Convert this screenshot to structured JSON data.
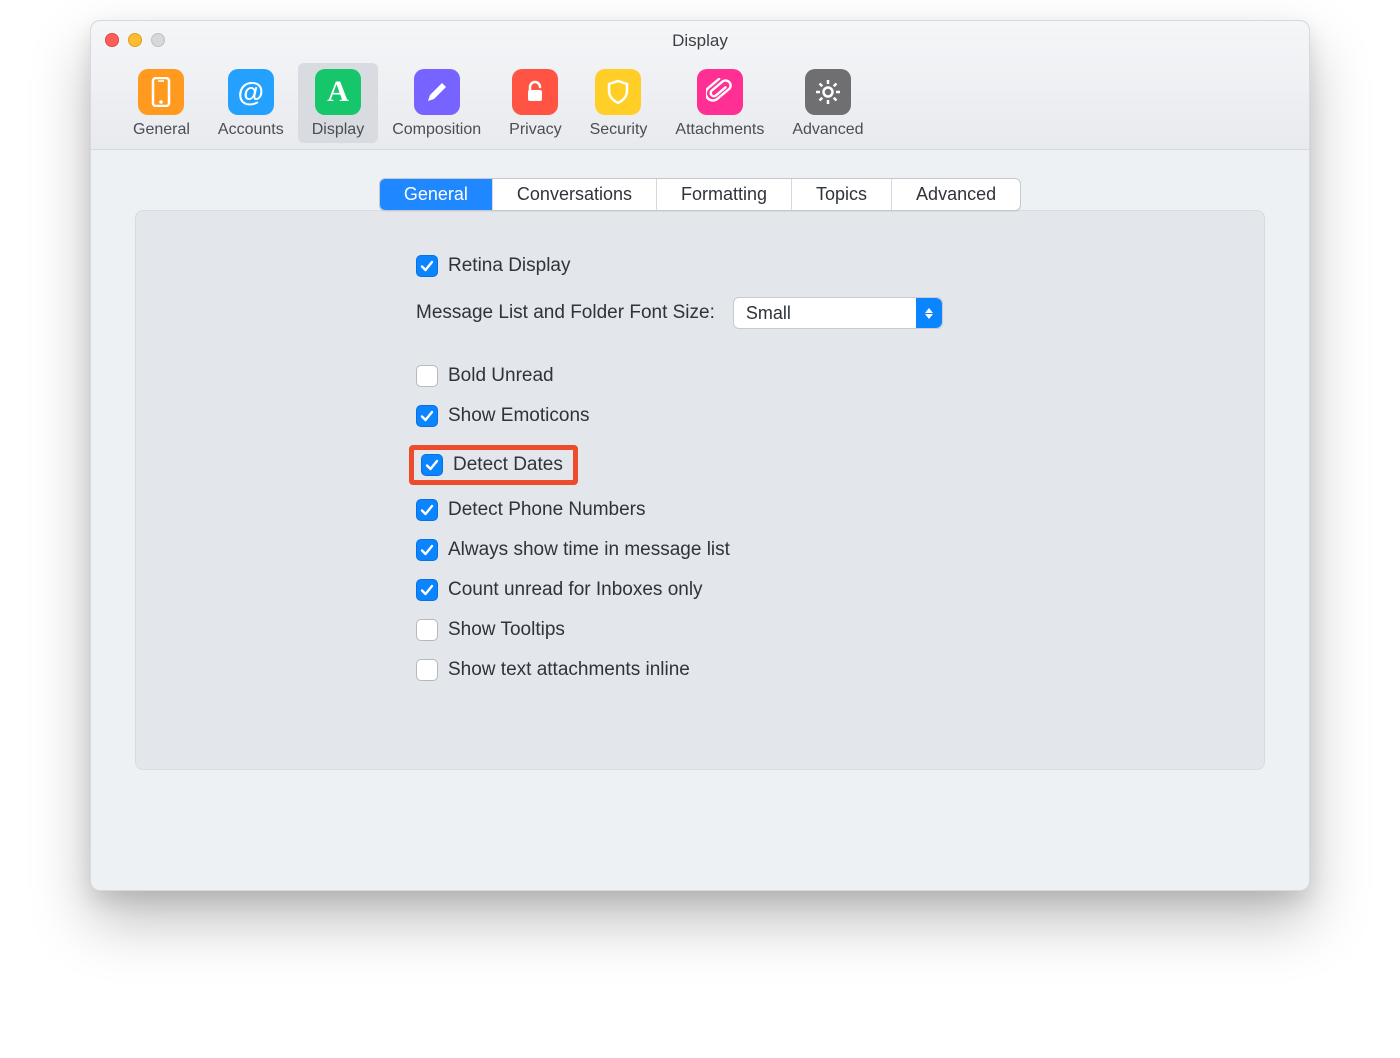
{
  "window": {
    "title": "Display"
  },
  "toolbar": {
    "items": [
      {
        "label": "General"
      },
      {
        "label": "Accounts"
      },
      {
        "label": "Display"
      },
      {
        "label": "Composition"
      },
      {
        "label": "Privacy"
      },
      {
        "label": "Security"
      },
      {
        "label": "Attachments"
      },
      {
        "label": "Advanced"
      }
    ],
    "active_index": 2
  },
  "tabs": {
    "items": [
      "General",
      "Conversations",
      "Formatting",
      "Topics",
      "Advanced"
    ],
    "active_index": 0
  },
  "settings": {
    "retina_display": {
      "label": "Retina Display",
      "checked": true
    },
    "font_size_label": "Message List and Folder Font Size:",
    "font_size_value": "Small",
    "bold_unread": {
      "label": "Bold Unread",
      "checked": false
    },
    "show_emoticons": {
      "label": "Show Emoticons",
      "checked": true
    },
    "detect_dates": {
      "label": "Detect Dates",
      "checked": true
    },
    "detect_phone": {
      "label": "Detect Phone Numbers",
      "checked": true
    },
    "always_time": {
      "label": "Always show time in message list",
      "checked": true
    },
    "count_unread": {
      "label": "Count unread for Inboxes only",
      "checked": true
    },
    "show_tooltips": {
      "label": "Show Tooltips",
      "checked": false
    },
    "show_text_attachments": {
      "label": "Show text attachments inline",
      "checked": false
    }
  },
  "icons": {
    "general": "phone-icon",
    "accounts": "at-icon",
    "display": "letter-a-icon",
    "composition": "pencil-icon",
    "privacy": "lock-open-icon",
    "security": "shield-icon",
    "attachments": "paperclip-icon",
    "advanced": "gear-icon"
  }
}
